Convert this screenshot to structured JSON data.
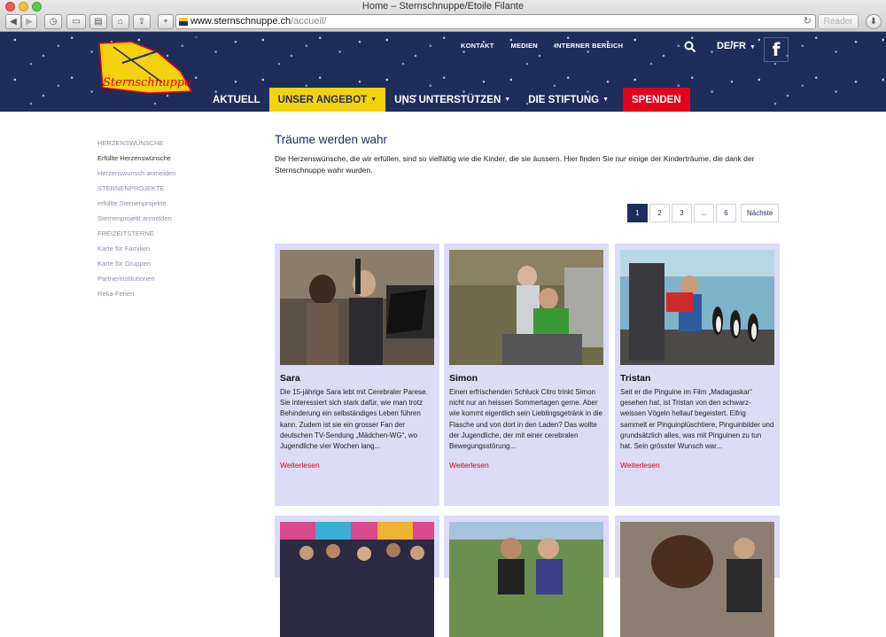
{
  "browser": {
    "window_title": "Home – Sternschnuppe/Etoile Filante",
    "url_host": "www.sternschnuppe.ch",
    "url_path": "/accueil/",
    "reader_label": "Reader"
  },
  "header": {
    "logo_text": "Sternschnuppe",
    "top_links": [
      "KONTAKT",
      "MEDIEN",
      "INTERNER BEREICH"
    ],
    "language": "DE/FR",
    "facebook_glyph": "f",
    "nav": [
      {
        "label": "AKTUELL",
        "dropdown": false
      },
      {
        "label": "UNSER ANGEBOT",
        "dropdown": true
      },
      {
        "label": "UNS UNTERSTÜTZEN",
        "dropdown": true
      },
      {
        "label": "DIE STIFTUNG",
        "dropdown": true
      },
      {
        "label": "SPENDEN",
        "dropdown": false
      }
    ]
  },
  "sidebar": {
    "items": [
      "HERZENSWÜNSCHE",
      "Erfüllte Herzenswünsche",
      "Herzenswunsch anmelden",
      "STERNENPROJEKTE",
      "erfüllte Sternenprojekte",
      "Sternenprojekt anmelden",
      "FREIZEITSTERNE",
      "Karte für Familien",
      "Karte für Gruppen",
      "Partnerinstitutionen",
      "Reka-Ferien"
    ]
  },
  "main": {
    "title": "Träume werden wahr",
    "intro": "Die Herzenswünsche, die wir erfüllen, sind so vielfältig wie die Kinder, die sie äussern. Hier finden Sie nur einige der Kinderträume, die dank der Sternschnuppe wahr wurden.",
    "pagination": [
      "1",
      "2",
      "3",
      "...",
      "6",
      "Nächste"
    ],
    "cards": [
      {
        "name": "Sara",
        "text": "Die 15-jährige Sara lebt mit Cerebraler Parese. Sie interessiert sich stark dafür, wie man trotz Behinderung ein selbständiges Leben führen kann. Zudem ist sie ein grosser Fan der deutschen TV-Sendung „Mädchen-WG“, wo Jugendliche vier Wochen lang...",
        "more": "Weiterlesen"
      },
      {
        "name": "Simon",
        "text": "Einen erfrischenden Schluck Citro trinkt Simon nicht nur an heissen Sommertagen gerne. Aber wie kommt eigentlich sein Lieblingsgetränk in die Flasche und von dort in den Laden? Das wollte der Jugendliche, der mit einer cerebralen Bewegungsstörung...",
        "more": "Weiterlesen"
      },
      {
        "name": "Tristan",
        "text": "Seit er die Pinguine im Film „Madagaskar“ gesehen hat, ist Tristan von den schwarz-weissen Vögeln hellauf begeistert. Eifrig sammelt er Pinguinplüschtiere, Pinguinbilder und grundsätzlich alles, was mit Pinguinen zu tun hat. Sein grösster Wunsch war...",
        "more": "Weiterlesen"
      }
    ]
  }
}
